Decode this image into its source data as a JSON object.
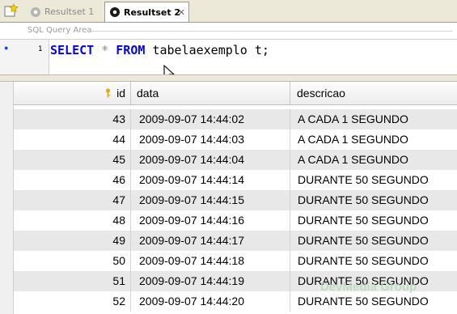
{
  "tabs": [
    {
      "label": "Resultset 1",
      "active": false
    },
    {
      "label": "Resultset 2",
      "active": true
    }
  ],
  "sql_area": {
    "label": "SQL Query Area",
    "line_number": "1",
    "query": {
      "select_kw": "SELECT",
      "star": "*",
      "from_kw": "FROM",
      "rest": "tabelaexemplo t;"
    }
  },
  "grid": {
    "columns": {
      "id": "id",
      "data": "data",
      "descricao": "descricao"
    },
    "rows": [
      {
        "id": "43",
        "data": "2009-09-07 14:44:02",
        "descricao": "A CADA 1 SEGUNDO"
      },
      {
        "id": "44",
        "data": "2009-09-07 14:44:03",
        "descricao": "A CADA 1 SEGUNDO"
      },
      {
        "id": "45",
        "data": "2009-09-07 14:44:04",
        "descricao": "A CADA 1 SEGUNDO"
      },
      {
        "id": "46",
        "data": "2009-09-07 14:44:14",
        "descricao": "DURANTE 50 SEGUNDO"
      },
      {
        "id": "47",
        "data": "2009-09-07 14:44:15",
        "descricao": "DURANTE 50 SEGUNDO"
      },
      {
        "id": "48",
        "data": "2009-09-07 14:44:16",
        "descricao": "DURANTE 50 SEGUNDO"
      },
      {
        "id": "49",
        "data": "2009-09-07 14:44:17",
        "descricao": "DURANTE 50 SEGUNDO"
      },
      {
        "id": "50",
        "data": "2009-09-07 14:44:18",
        "descricao": "DURANTE 50 SEGUNDO"
      },
      {
        "id": "51",
        "data": "2009-09-07 14:44:19",
        "descricao": "DURANTE 50 SEGUNDO"
      },
      {
        "id": "52",
        "data": "2009-09-07 14:44:20",
        "descricao": "DURANTE 50 SEGUNDO"
      }
    ]
  },
  "watermark": "DevMedia Group",
  "icons": {
    "new_tab": "new-tab-icon",
    "inactive_tab": "gear-icon",
    "active_tab": "gear-icon",
    "close": "close-icon",
    "key": "key-icon"
  },
  "colors": {
    "keyword": "#0000ff",
    "odd_row": "#e8e8e8",
    "tab_strip": "#ece9d8"
  }
}
